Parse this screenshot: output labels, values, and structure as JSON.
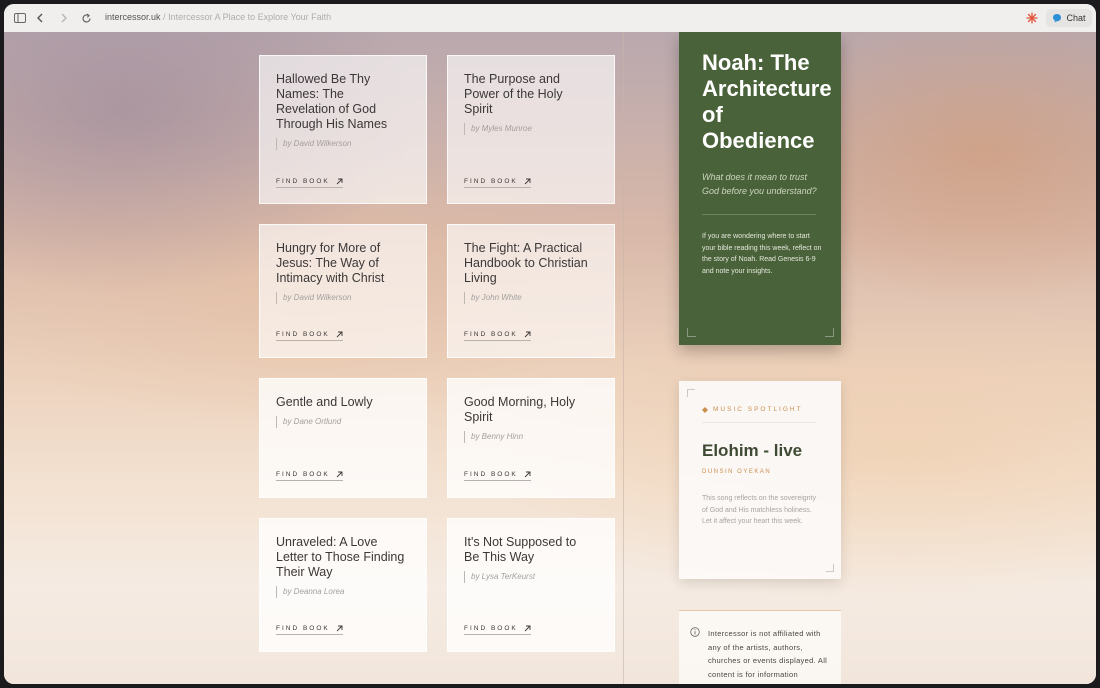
{
  "browser": {
    "url_host": "intercessor.uk",
    "url_separator": "/",
    "page_title": "Intercessor A Place to Explore Your Faith",
    "chat_label": "Chat",
    "icons": [
      "sidebar-icon",
      "back-arrow-icon",
      "forward-arrow-icon",
      "reload-icon",
      "extension-icon",
      "chat-icon"
    ]
  },
  "books": [
    {
      "title": "Hallowed Be Thy Names: The Revelation of God Through His Names",
      "author": "by David Wilkerson",
      "cta": "FIND BOOK"
    },
    {
      "title": "The Purpose and Power of the Holy Spirit",
      "author": "by Myles Munroe",
      "cta": "FIND BOOK"
    },
    {
      "title": "Hungry for More of Jesus: The Way of Intimacy with Christ",
      "author": "by David Wilkerson",
      "cta": "FIND BOOK"
    },
    {
      "title": "The Fight: A Practical Handbook to Christian Living",
      "author": "by John White",
      "cta": "FIND BOOK"
    },
    {
      "title": "Gentle and Lowly",
      "author": "by Dane Ortlund",
      "cta": "FIND BOOK"
    },
    {
      "title": "Good Morning, Holy Spirit",
      "author": "by Benny Hinn",
      "cta": "FIND BOOK"
    },
    {
      "title": "Unraveled: A Love Letter to Those Finding Their Way",
      "author": "by Deanna Lorea",
      "cta": "FIND BOOK"
    },
    {
      "title": "It's Not Supposed to Be This Way",
      "author": "by Lysa TerKeurst",
      "cta": "FIND BOOK"
    }
  ],
  "feature": {
    "title": "Noah: The Architecture of Obedience",
    "question": "What does it mean to trust God before you understand?",
    "body": "If you are wondering where to start your bible reading this week, reflect on the story of Noah. Read Genesis 6-9 and note your insights.",
    "color": "#4a6239"
  },
  "music": {
    "label": "MUSIC SPOTLIGHT",
    "title": "Elohim - live",
    "artist": "DUNSIN OYEKAN",
    "body": "This song reflects on the sovereignty of God and His matchless holiness. Let it affect your heart this week.",
    "accent": "#c98f4f"
  },
  "disclaimer": {
    "text": "Intercessor is not affiliated with any of the artists, authors, churches or events displayed. All content is for information purposes only and"
  }
}
